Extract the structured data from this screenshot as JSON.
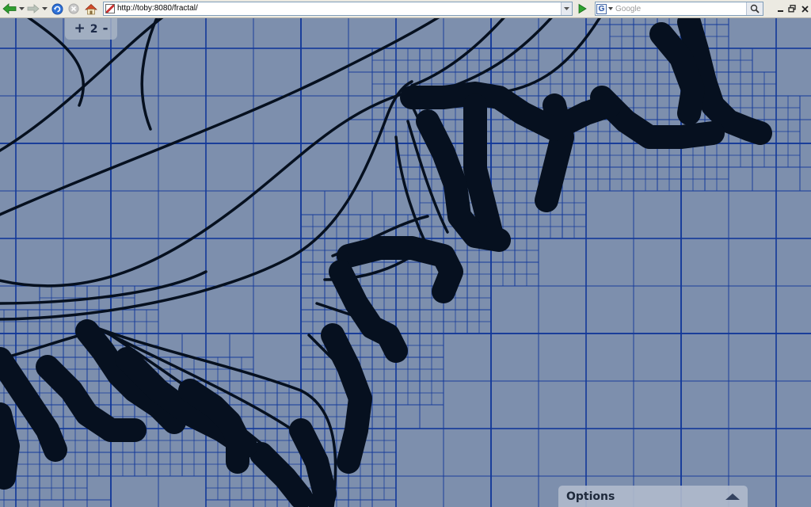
{
  "browser": {
    "url": "http://toby:8080/fractal/",
    "search_placeholder": "Google",
    "search_engine_icon": "google-icon",
    "colors": {
      "toolbar": "#eceae2",
      "back_arrow": "#2f9e2f",
      "go_arrow": "#2fa32f"
    }
  },
  "zoom": {
    "plus": "+",
    "level": "2",
    "minus": "-"
  },
  "options": {
    "title": "Options"
  },
  "fractal": {
    "colors": {
      "background": "#7d8fad",
      "grid": "#13389a",
      "fill": "#06101f"
    }
  }
}
